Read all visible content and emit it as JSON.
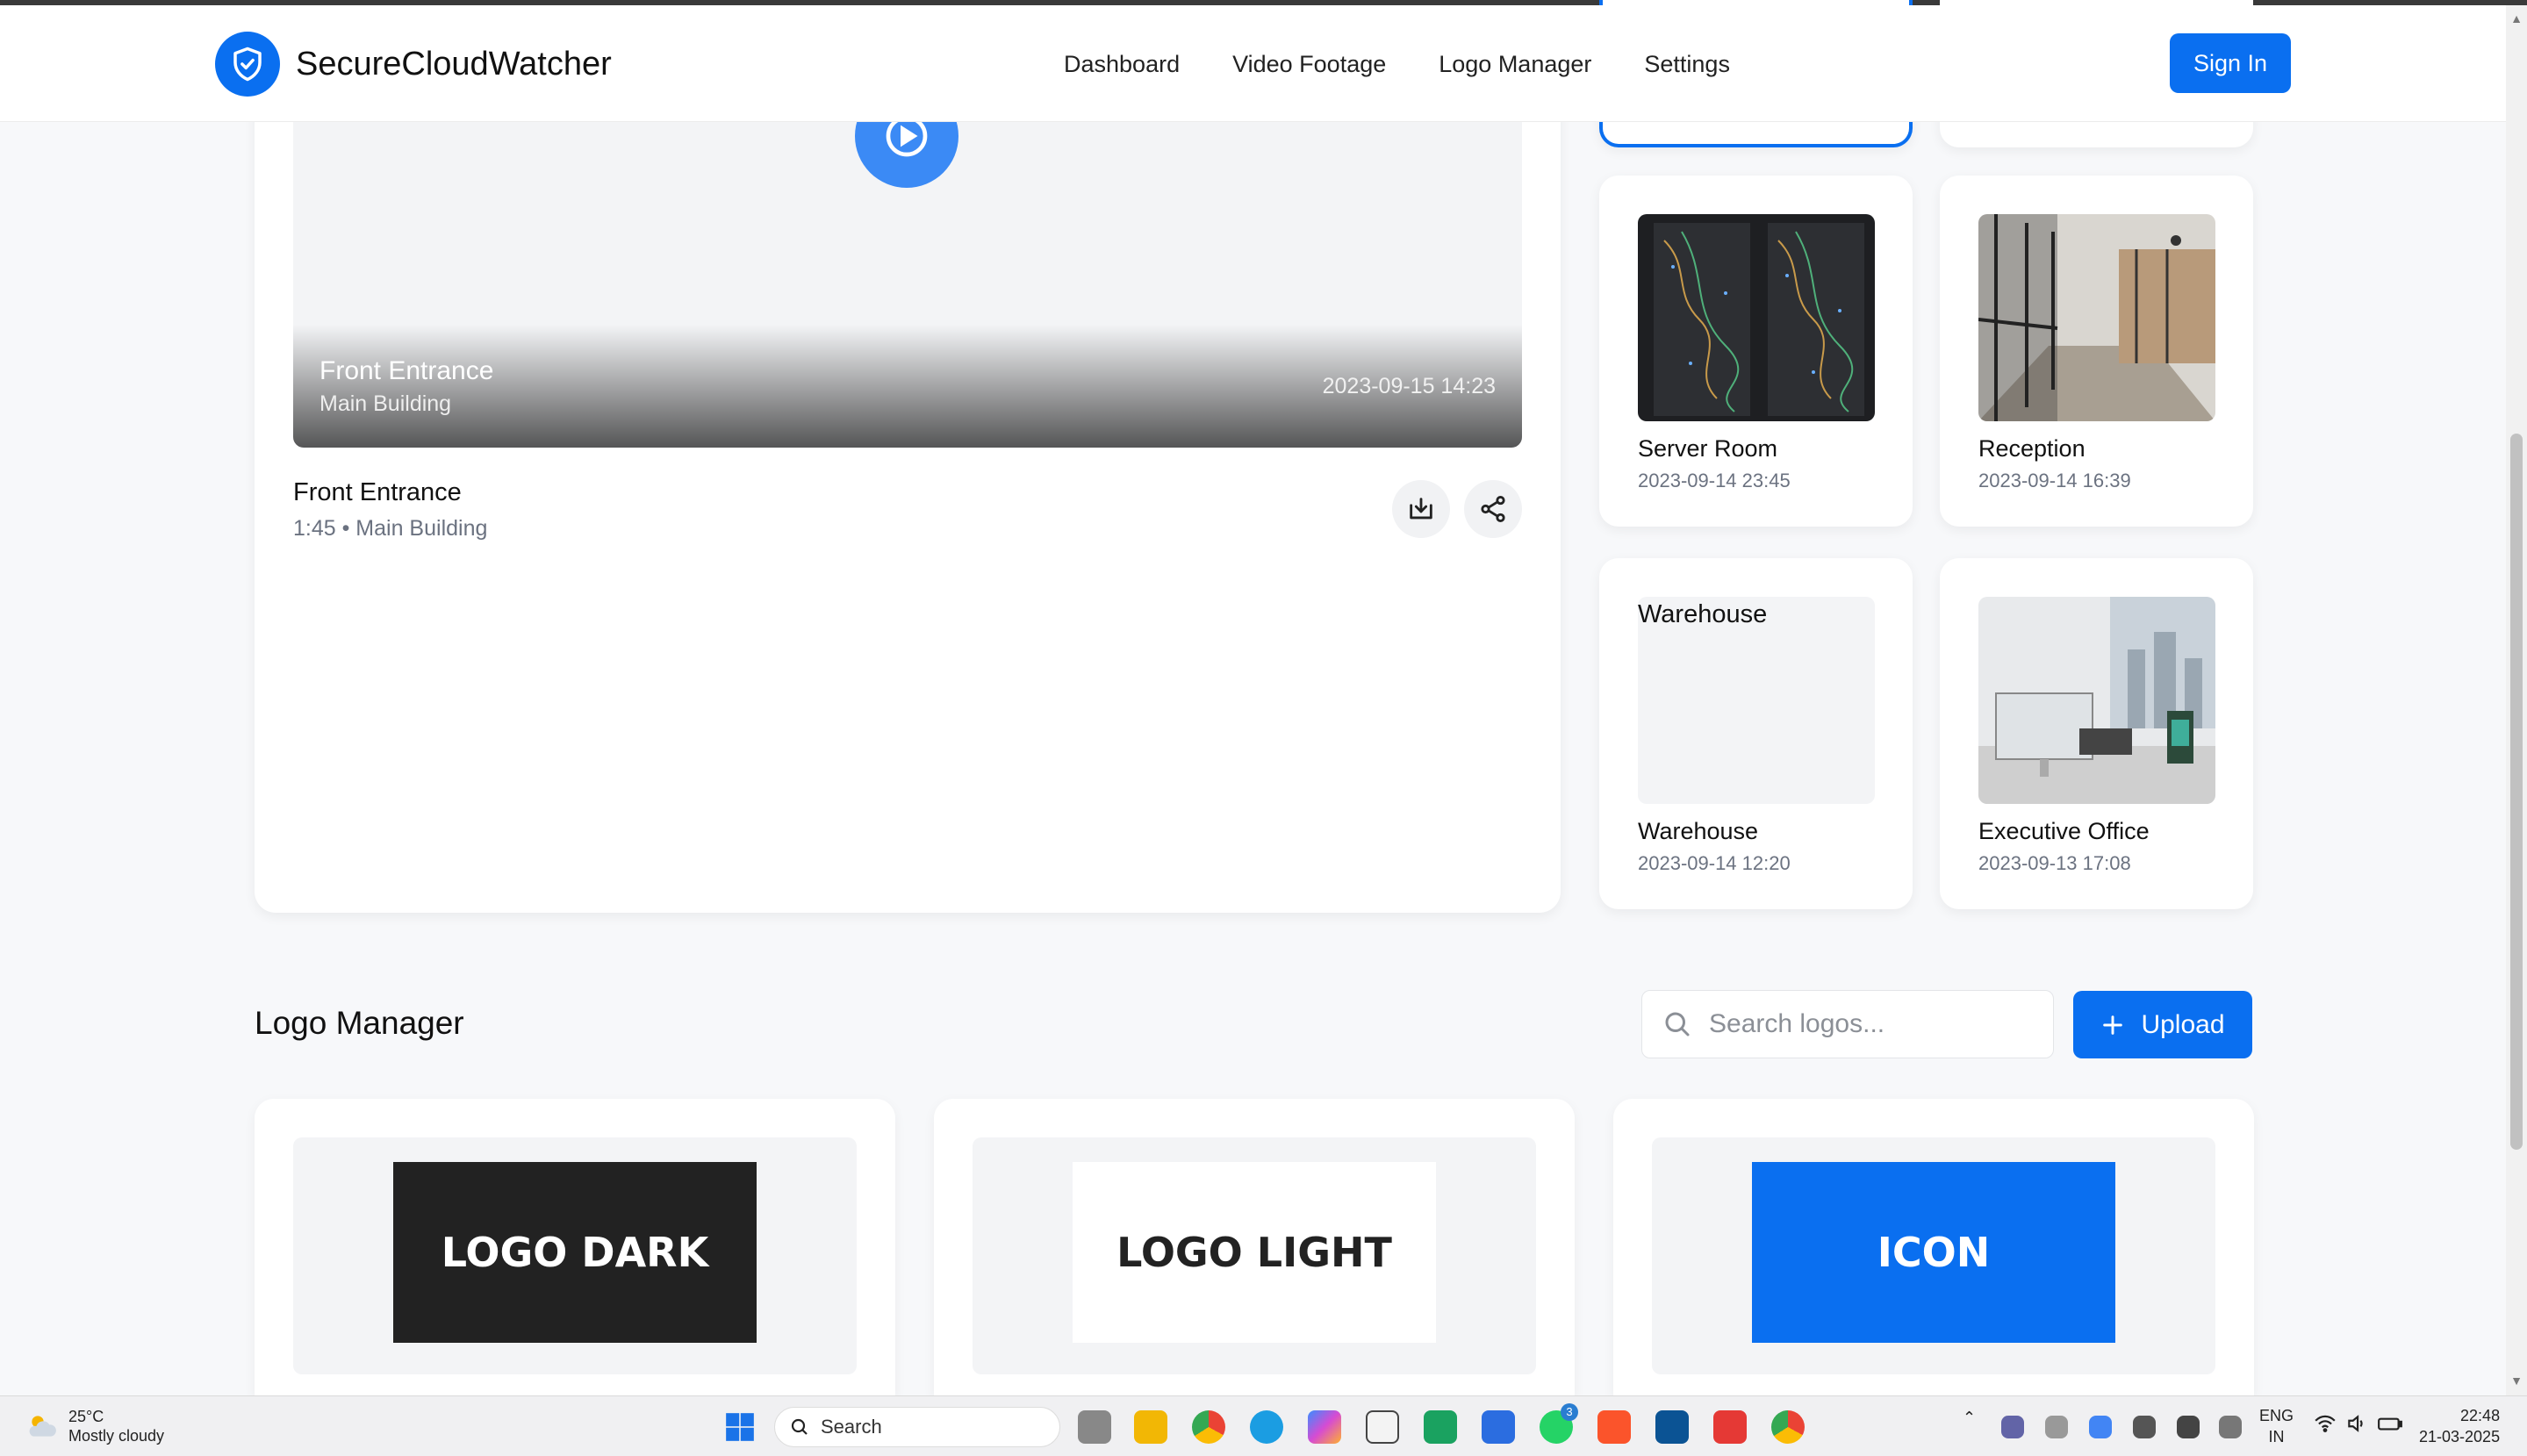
{
  "brand": {
    "name": "SecureCloudWatcher"
  },
  "nav": [
    "Dashboard",
    "Video Footage",
    "Logo Manager",
    "Settings"
  ],
  "header": {
    "signin_label": "Sign In"
  },
  "player": {
    "overlay_title": "Front Entrance",
    "overlay_subtitle": "Main Building",
    "overlay_timestamp": "2023-09-15 14:23",
    "title": "Front Entrance",
    "meta": "1:45 • Main Building"
  },
  "thumbnails": [
    {
      "name": "Server Room",
      "date": "2023-09-14 23:45"
    },
    {
      "name": "Reception",
      "date": "2023-09-14 16:39"
    },
    {
      "name": "Warehouse",
      "date": "2023-09-14 12:20",
      "broken_alt": "Warehouse"
    },
    {
      "name": "Executive Office",
      "date": "2023-09-13 17:08"
    }
  ],
  "logo_manager": {
    "title": "Logo Manager",
    "search_placeholder": "Search logos...",
    "upload_label": "Upload",
    "logos": [
      {
        "label": "LOGO DARK",
        "bg": "#222222",
        "fg": "#ffffff"
      },
      {
        "label": "LOGO LIGHT",
        "bg": "#ffffff",
        "fg": "#222222"
      },
      {
        "label": "ICON",
        "bg": "#0a6ff0",
        "fg": "#ffffff"
      }
    ]
  },
  "colors": {
    "accent": "#0a6ff0"
  },
  "taskbar": {
    "weather_temp": "25°C",
    "weather_condition": "Mostly cloudy",
    "search_label": "Search",
    "lang_1": "ENG",
    "lang_2": "IN",
    "time": "22:48",
    "date": "21-03-2025",
    "whatsapp_badge": "3"
  }
}
